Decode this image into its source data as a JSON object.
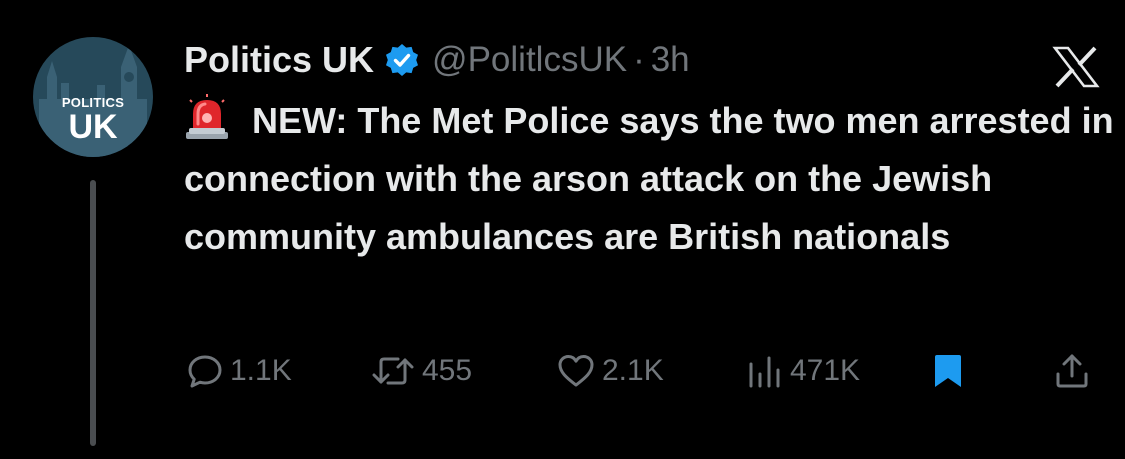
{
  "post": {
    "author": {
      "display_name": "Politics UK",
      "handle": "@PolitlcsUK",
      "verified": true,
      "avatar": {
        "top_text": "POLITICS",
        "big_text": "UK",
        "bg_color": "#26495a"
      }
    },
    "separator": "·",
    "time": "3h",
    "emoji": "rotating-light-icon",
    "text": "NEW: The Met Police says the two men arrested in connection with the arson attack on the Jewish community ambulances are British nationals",
    "metrics": {
      "replies": "1.1K",
      "reposts": "455",
      "likes": "2.1K",
      "views": "471K"
    },
    "bookmarked": true
  },
  "icons": {
    "platform": "x-logo-icon",
    "reply": "speech-bubble-icon",
    "repost": "repost-arrows-icon",
    "like": "heart-icon",
    "views": "bar-chart-icon",
    "bookmark": "bookmark-icon",
    "share": "share-icon"
  },
  "colors": {
    "background": "#000000",
    "text_primary": "#e7e9ea",
    "text_secondary": "#71767b",
    "accent_blue": "#1d9bf0",
    "thread_line": "#4a4d50"
  }
}
